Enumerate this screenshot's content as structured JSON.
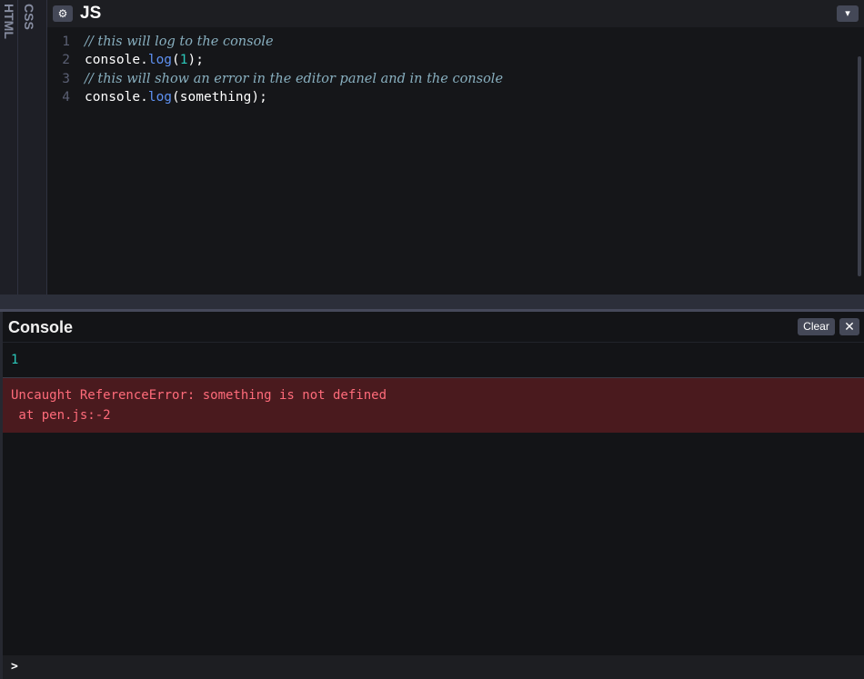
{
  "side_tabs": [
    {
      "label": "HTML"
    },
    {
      "label": "CSS"
    }
  ],
  "editor": {
    "title": "JS",
    "settings_icon": "gear-icon",
    "collapse_icon": "chevron-down-icon",
    "error_icon": "error-icon",
    "lines": [
      {
        "number": "1",
        "parts": [
          {
            "text": "// this will log to the console",
            "kind": "comment"
          }
        ]
      },
      {
        "number": "2",
        "parts": [
          {
            "text": "console.",
            "kind": "plain"
          },
          {
            "text": "log",
            "kind": "func"
          },
          {
            "text": "(",
            "kind": "plain"
          },
          {
            "text": "1",
            "kind": "num"
          },
          {
            "text": ");",
            "kind": "plain"
          }
        ]
      },
      {
        "number": "3",
        "parts": [
          {
            "text": "// this will show an error in the editor panel and in the console",
            "kind": "comment"
          }
        ]
      },
      {
        "number": "4",
        "parts": [
          {
            "text": "console.",
            "kind": "plain"
          },
          {
            "text": "log",
            "kind": "func"
          },
          {
            "text": "(something);",
            "kind": "plain"
          }
        ]
      }
    ]
  },
  "console": {
    "title": "Console",
    "clear_label": "Clear",
    "close_label": "✕",
    "log_output": "1",
    "error_line1": "Uncaught ReferenceError: something is not defined",
    "error_line2": " at pen.js:-2",
    "prompt": ">"
  },
  "colors": {
    "background": "#131417",
    "editor_bg": "#151619",
    "comment": "#88afbf",
    "function": "#5e91f2",
    "number": "#2bc7b9",
    "error_bg": "#4a1a1e",
    "error_text": "#ff6b7a"
  }
}
